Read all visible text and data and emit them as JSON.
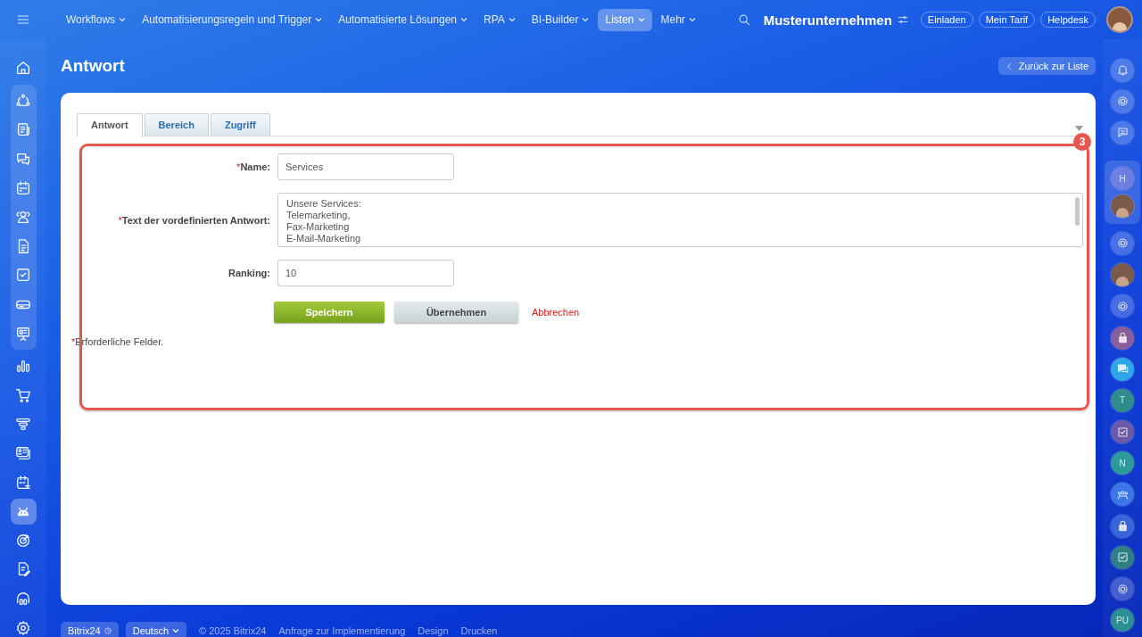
{
  "top_bar": {
    "menu": [
      {
        "label": "Workflows",
        "selected": false
      },
      {
        "label": "Automatisierungsregeln und Trigger",
        "selected": false
      },
      {
        "label": "Automatisierte Lösungen",
        "selected": false
      },
      {
        "label": "RPA",
        "selected": false
      },
      {
        "label": "BI-Builder",
        "selected": false
      },
      {
        "label": "Listen",
        "selected": true
      },
      {
        "label": "Mehr",
        "selected": false
      }
    ],
    "company": "Musterunternehmen",
    "buttons": [
      "Einladen",
      "Mein Tarif",
      "Helpdesk"
    ]
  },
  "left_sidebar": [
    {
      "kind": "item",
      "selected": false
    },
    {
      "kind": "group",
      "items": [
        {
          "selected": false
        },
        {
          "selected": false
        },
        {
          "selected": false
        },
        {
          "selected": false
        },
        {
          "selected": false
        },
        {
          "selected": false
        },
        {
          "selected": false
        },
        {
          "selected": false
        },
        {
          "selected": false
        }
      ]
    },
    {
      "kind": "item",
      "selected": false
    },
    {
      "kind": "item",
      "selected": false
    },
    {
      "kind": "item",
      "selected": false
    },
    {
      "kind": "item",
      "selected": false
    },
    {
      "kind": "item",
      "selected": false
    },
    {
      "kind": "item",
      "selected": true
    },
    {
      "kind": "item",
      "selected": false
    },
    {
      "kind": "item",
      "selected": false
    },
    {
      "kind": "item",
      "selected": false
    },
    {
      "kind": "item",
      "selected": false
    }
  ],
  "right_sidebar": [
    {
      "kind": "icon"
    },
    {
      "kind": "icon"
    },
    {
      "kind": "icon"
    },
    {
      "kind": "group",
      "items": [
        {
          "kind": "letter",
          "text": "H",
          "color": "#6f7fe0"
        },
        {
          "kind": "avatar"
        }
      ]
    },
    {
      "kind": "icon"
    },
    {
      "kind": "avatar"
    },
    {
      "kind": "icon"
    },
    {
      "kind": "icon",
      "color": "#8a5d9c"
    },
    {
      "kind": "icon",
      "color": "#2fa6e8"
    },
    {
      "kind": "letter",
      "text": "T",
      "color": "#2f8c8c"
    },
    {
      "kind": "icon",
      "color": "#6a5aa8"
    },
    {
      "kind": "letter",
      "text": "N",
      "color": "#2c9a9a"
    },
    {
      "kind": "icon",
      "color": "#3a78e6"
    },
    {
      "kind": "icon",
      "color": "#3766d8"
    },
    {
      "kind": "icon",
      "color": "#2f7f86"
    },
    {
      "kind": "icon"
    },
    {
      "kind": "letter",
      "text": "PU",
      "color": "#2c8f96"
    }
  ],
  "page": {
    "title": "Antwort",
    "back_button": "Zurück zur Liste"
  },
  "tabs": [
    {
      "label": "Antwort",
      "selected": true
    },
    {
      "label": "Bereich",
      "selected": false
    },
    {
      "label": "Zugriff",
      "selected": false
    }
  ],
  "form": {
    "fields": [
      {
        "kind": "input",
        "label": "Name:",
        "required": true,
        "value": "Services"
      },
      {
        "kind": "textarea",
        "label": "Text der vordefinierten Antwort:",
        "required": true,
        "value": "Unsere Services:\nTelemarketing,\nFax-Marketing\nE-Mail-Marketing"
      },
      {
        "kind": "input",
        "label": "Ranking:",
        "required": false,
        "value": "10"
      }
    ],
    "buttons": [
      {
        "kind": "primary",
        "label": "Speichern"
      },
      {
        "kind": "secondary",
        "label": "Übernehmen"
      },
      {
        "kind": "link",
        "label": "Abbrechen"
      }
    ],
    "required_mark": "*",
    "required_note": "Erforderliche Felder."
  },
  "callout": {
    "number": "3"
  },
  "footer": {
    "brand": "Bitrix24",
    "language": "Deutsch",
    "copyright": "© 2025 Bitrix24",
    "links": [
      "Anfrage zur Implementierung",
      "Design",
      "Drucken"
    ]
  }
}
